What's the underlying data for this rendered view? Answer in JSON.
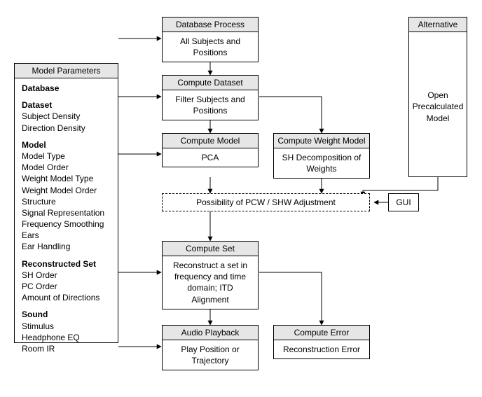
{
  "params": {
    "title": "Model Parameters",
    "groups": [
      {
        "cat": "Database",
        "items": []
      },
      {
        "cat": "Dataset",
        "items": [
          "Subject Density",
          "Direction Density"
        ]
      },
      {
        "cat": "Model",
        "items": [
          "Model Type",
          "Model Order",
          "Weight Model Type",
          "Weight Model Order",
          "Structure",
          "Signal Representation",
          "Frequency Smoothing",
          "Ears",
          "Ear Handling"
        ]
      },
      {
        "cat": "Reconstructed Set",
        "items": [
          "SH Order",
          "PC Order",
          "Amount of Directions"
        ]
      },
      {
        "cat": "Sound",
        "items": [
          "Stimulus",
          "Headphone EQ",
          "Room IR"
        ]
      }
    ]
  },
  "col": {
    "db": {
      "title": "Database Process",
      "body": "All Subjects and Positions"
    },
    "ds": {
      "title": "Compute Dataset",
      "body": "Filter Subjects and Positions"
    },
    "model": {
      "title": "Compute Model",
      "body": "PCA"
    },
    "wmodel": {
      "title": "Compute Weight Model",
      "body": "SH Decomposition of Weights"
    },
    "set": {
      "title": "Compute Set",
      "body": "Reconstruct a set in frequency and time domain; ITD Alignment"
    },
    "play": {
      "title": "Audio Playback",
      "body": "Play Position or Trajectory"
    },
    "err": {
      "title": "Compute Error",
      "body": "Reconstruction Error"
    }
  },
  "alt": {
    "title": "Alternative",
    "body": "Open Precalculated Model"
  },
  "adj": {
    "text": "Possibility of PCW / SHW Adjustment"
  },
  "gui": {
    "label": "GUI"
  }
}
